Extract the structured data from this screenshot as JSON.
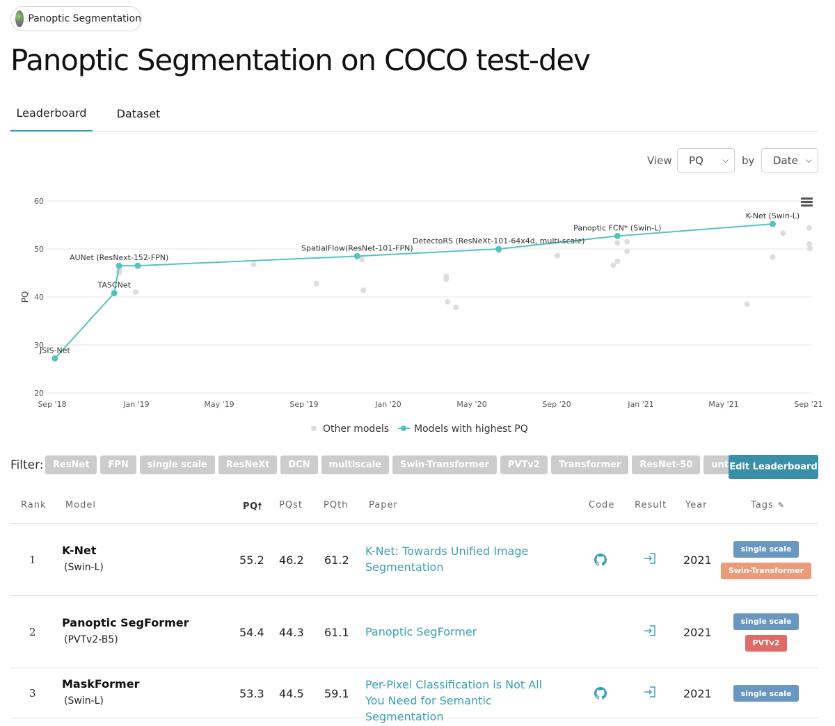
{
  "task": {
    "label": "Panoptic Segmentation"
  },
  "page": {
    "title": "Panoptic Segmentation on COCO test-dev"
  },
  "tabs": [
    {
      "label": "Leaderboard",
      "active": true
    },
    {
      "label": "Dataset",
      "active": false
    }
  ],
  "controls": {
    "view_label": "View",
    "view_value": "PQ",
    "by_label": "by",
    "by_value": "Date"
  },
  "chart_data": {
    "type": "scatter",
    "ylabel": "PQ",
    "ylim": [
      20,
      60
    ],
    "yticks": [
      20,
      30,
      40,
      50,
      60
    ],
    "xlim": [
      "2018-08-26",
      "2021-09-05"
    ],
    "xticks": [
      {
        "date": "2018-09-01",
        "label": "Sep '18"
      },
      {
        "date": "2019-01-01",
        "label": "Jan '19"
      },
      {
        "date": "2019-05-01",
        "label": "May '19"
      },
      {
        "date": "2019-09-01",
        "label": "Sep '19"
      },
      {
        "date": "2020-01-01",
        "label": "Jan '20"
      },
      {
        "date": "2020-05-01",
        "label": "May '20"
      },
      {
        "date": "2020-09-01",
        "label": "Sep '20"
      },
      {
        "date": "2021-01-01",
        "label": "Jan '21"
      },
      {
        "date": "2021-05-01",
        "label": "May '21"
      },
      {
        "date": "2021-09-01",
        "label": "Sep '21"
      }
    ],
    "grid": true,
    "legend_position": "bottom",
    "series": [
      {
        "name": "Other models",
        "color": "#dddddd",
        "points": [
          {
            "x": "2018-12-07",
            "y": 45.5
          },
          {
            "x": "2018-12-07",
            "y": 45.0
          },
          {
            "x": "2018-12-31",
            "y": 41.0
          },
          {
            "x": "2019-06-20",
            "y": 46.8
          },
          {
            "x": "2019-09-19",
            "y": 42.8
          },
          {
            "x": "2019-11-24",
            "y": 47.8
          },
          {
            "x": "2019-11-26",
            "y": 41.4
          },
          {
            "x": "2020-03-25",
            "y": 44.3
          },
          {
            "x": "2020-03-25",
            "y": 43.7
          },
          {
            "x": "2020-03-27",
            "y": 39.0
          },
          {
            "x": "2020-04-08",
            "y": 37.8
          },
          {
            "x": "2020-06-09",
            "y": 49.6
          },
          {
            "x": "2020-09-02",
            "y": 48.6
          },
          {
            "x": "2020-11-22",
            "y": 46.6
          },
          {
            "x": "2020-11-28",
            "y": 51.3
          },
          {
            "x": "2020-11-28",
            "y": 47.4
          },
          {
            "x": "2020-12-12",
            "y": 51.5
          },
          {
            "x": "2020-12-12",
            "y": 49.5
          },
          {
            "x": "2021-06-04",
            "y": 38.5
          },
          {
            "x": "2021-07-11",
            "y": 48.3
          },
          {
            "x": "2021-07-26",
            "y": 53.3
          },
          {
            "x": "2021-09-02",
            "y": 54.4
          },
          {
            "x": "2021-09-02",
            "y": 51.0
          },
          {
            "x": "2021-09-03",
            "y": 50.1
          }
        ]
      },
      {
        "name": "Models with highest PQ",
        "color": "#56c2c0",
        "points": [
          {
            "x": "2018-09-05",
            "y": 27.2,
            "label": "JSIS-Net"
          },
          {
            "x": "2018-11-30",
            "y": 40.8,
            "label": "TASCNet"
          },
          {
            "x": "2018-12-07",
            "y": 46.5,
            "label": "AUNet (ResNext-152-FPN)"
          },
          {
            "x": "2019-01-03",
            "y": 46.5,
            "label": ""
          },
          {
            "x": "2019-11-17",
            "y": 48.5,
            "label": "SpatialFlow(ResNet-101-FPN)"
          },
          {
            "x": "2020-06-09",
            "y": 50.0,
            "label": "DetectoRS (ResNeXt-101-64x4d, multi-scale)"
          },
          {
            "x": "2020-11-28",
            "y": 52.7,
            "label": "Panoptic FCN* (Swin-L)"
          },
          {
            "x": "2021-07-11",
            "y": 55.2,
            "label": "K-Net (Swin-L)"
          }
        ]
      }
    ]
  },
  "filters": {
    "label": "Filter:",
    "tags": [
      "ResNet",
      "FPN",
      "single scale",
      "ResNeXt",
      "DCN",
      "multiscale",
      "Swin-Transformer",
      "PVTv2",
      "Transformer",
      "ResNet-50",
      "untagged"
    ],
    "edit_button": "Edit Leaderboard"
  },
  "table": {
    "headers": {
      "rank": "Rank",
      "model": "Model",
      "pq": "PQ",
      "pqst": "PQst",
      "pqth": "PQth",
      "paper": "Paper",
      "code": "Code",
      "result": "Result",
      "year": "Year",
      "tags": "Tags"
    },
    "rows": [
      {
        "rank": "1",
        "model": "K-Net",
        "model_sub": "(Swin-L)",
        "pq": "55.2",
        "pqst": "46.2",
        "pqth": "61.2",
        "paper": "K-Net: Towards Unified Image Segmentation",
        "has_code": true,
        "year": "2021",
        "tags": [
          {
            "label": "single scale",
            "color": "#6a97c0"
          },
          {
            "label": "Swin-Transformer",
            "color": "#ec9b78"
          }
        ]
      },
      {
        "rank": "2",
        "model": "Panoptic SegFormer",
        "model_sub": "(PVTv2-B5)",
        "pq": "54.4",
        "pqst": "44.3",
        "pqth": "61.1",
        "paper": "Panoptic SegFormer",
        "has_code": false,
        "year": "2021",
        "tags": [
          {
            "label": "single scale",
            "color": "#6a97c0"
          },
          {
            "label": "PVTv2",
            "color": "#de6b66"
          }
        ]
      },
      {
        "rank": "3",
        "model": "MaskFormer",
        "model_sub": "(Swin-L)",
        "pq": "53.3",
        "pqst": "44.5",
        "pqth": "59.1",
        "paper": "Per-Pixel Classification is Not All You Need for Semantic Segmentation",
        "has_code": true,
        "year": "2021",
        "tags": [
          {
            "label": "single scale",
            "color": "#6a97c0"
          }
        ]
      }
    ]
  }
}
